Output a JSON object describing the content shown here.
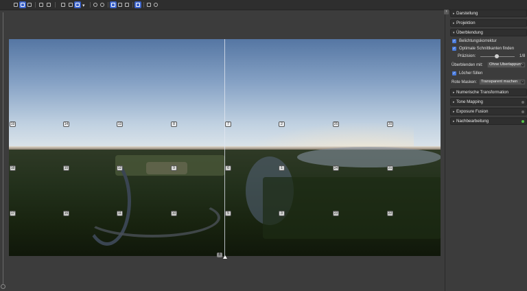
{
  "toolbar": {
    "icons": [
      "overlap-images-icon",
      "select-images-icon",
      "move-icon",
      "crop-icon",
      "crosshair-icon",
      "rectangle-icon",
      "mouse-icon",
      "zoom-fit-icon",
      "dropdown-icon",
      "search-icon",
      "eye-icon",
      "frame-icon",
      "half-icon",
      "split-icon",
      "layout-icon",
      "layers-icon",
      "circle-icon"
    ]
  },
  "control_points": {
    "row1": [
      "19",
      "14",
      "13",
      "8",
      "7",
      "2",
      "25",
      "20"
    ],
    "row2": [
      "18",
      "15",
      "12",
      "9",
      "6",
      "1",
      "24",
      "21"
    ],
    "row3": [
      "17",
      "16",
      "11",
      "10",
      "5",
      "3",
      "23",
      "22"
    ]
  },
  "center_handle": "8",
  "panel": {
    "sections": {
      "darstellung": "Darstellung",
      "projektion": "Projektion",
      "ueberblendung": "Überblendung",
      "numerische": "Numerische Transformation",
      "tonemapping": "Tone Mapping",
      "exposure": "Exposure Fusion",
      "nachbearbeitung": "Nachbearbeitung"
    },
    "blend": {
      "belichtung": "Belichtungskorrektur",
      "schnittkanten": "Optimale Schnittkanten finden",
      "praezision_label": "Präzision:",
      "praezision_value": "1/8",
      "ueberblenden_label": "Überblenden mit:",
      "ueberblenden_value": "Ohne Überlappung",
      "loecher": "Löcher füllen",
      "rote_label": "Rote Masken:",
      "rote_value": "Transparent machen"
    },
    "status_colors": {
      "inactive": "#6a6a6a",
      "active": "#58c24a"
    }
  }
}
